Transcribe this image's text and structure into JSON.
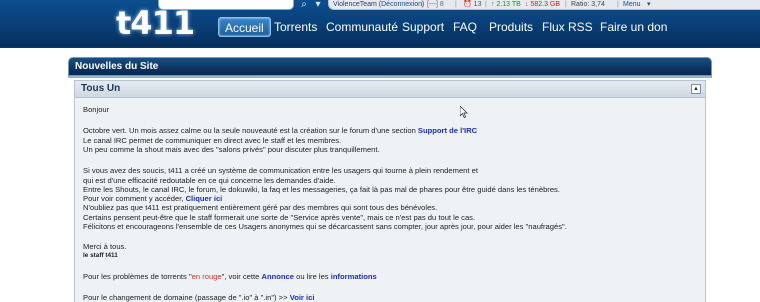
{
  "header": {
    "logo": "t411",
    "search": {
      "placeholder": "",
      "value": ""
    },
    "topbar": {
      "user": "ViolenceTeam",
      "deconnexion": "(Déconnexion)",
      "sep1": "|",
      "messages": "[---] 8",
      "sep2": "|",
      "notifications": "13",
      "sep3": "|",
      "upload": "2.13 TB",
      "download": "582.3 GB",
      "sep4": "|",
      "ratio": "Ratio: 3,74",
      "sep5": "|",
      "menu": "Menu",
      "menu_caret": "▾"
    },
    "nav": [
      {
        "label": "Accueil",
        "active": true
      },
      {
        "label": "Torrents"
      },
      {
        "label": "Communauté"
      },
      {
        "label": "Support"
      },
      {
        "label": "FAQ"
      },
      {
        "label": "Produits"
      },
      {
        "label": "Flux RSS"
      },
      {
        "label": "Faire un don"
      }
    ]
  },
  "news": {
    "bar_title": "Nouvelles du Site",
    "panel_title": "Tous Un",
    "collapse_symbol": "▲",
    "lines": {
      "l1": "Bonjour",
      "l2a": "Octobre vert. Un mois assez calme ou la seule nouveauté est la création sur le forum d'une section",
      "l2b": "Support de l'IRC",
      "l3": "Le canal IRC permet de communiquer en direct avec le staff et les membres.",
      "l4": "Un peu comme la shout mais avec des \"salons privés\" pour discuter plus tranquillement.",
      "l5": "Si vous avez des soucis, t411 a créé un système de communication entre les usagers qui tourne à plein rendement et",
      "l6": "qui est d'une efficacité redoutable en ce qui concerne les demandes d'aide.",
      "l7": "Entre les Shouts, le canal IRC, le forum, le dokuwiki, la faq et les messageries, ça fait là pas mal de phares pour être guidé dans les ténèbres.",
      "l8a": "Pour voir comment y accéder,",
      "l8b": "Cliquer ici",
      "l9": "N'oubliez pas que t411 est pratiquement entièrement géré par des membres qui sont tous des bénévoles.",
      "l10": "Certains pensent peut-être que le staff formerait une sorte de \"Service après vente\", mais ce n'est pas du tout le cas.",
      "l11": "Félicitons et encourageons l'ensemble de ces Usagers anonymes qui se décarcassent sans compter, jour après jour, pour aider les \"naufragés\".",
      "l12": "Merci à tous.",
      "l13": "le staff t411",
      "l14a": "Pour les problèmes de torrents \"",
      "l14b": "en rouge",
      "l14c": "\", voir cette",
      "l14d": "Annonce",
      "l14e": "ou lire les",
      "l14f": "informations",
      "l15a": "Pour le changement de domaine (passage de \".io\" à \".in\") >>",
      "l15b": "Voir ici"
    }
  }
}
